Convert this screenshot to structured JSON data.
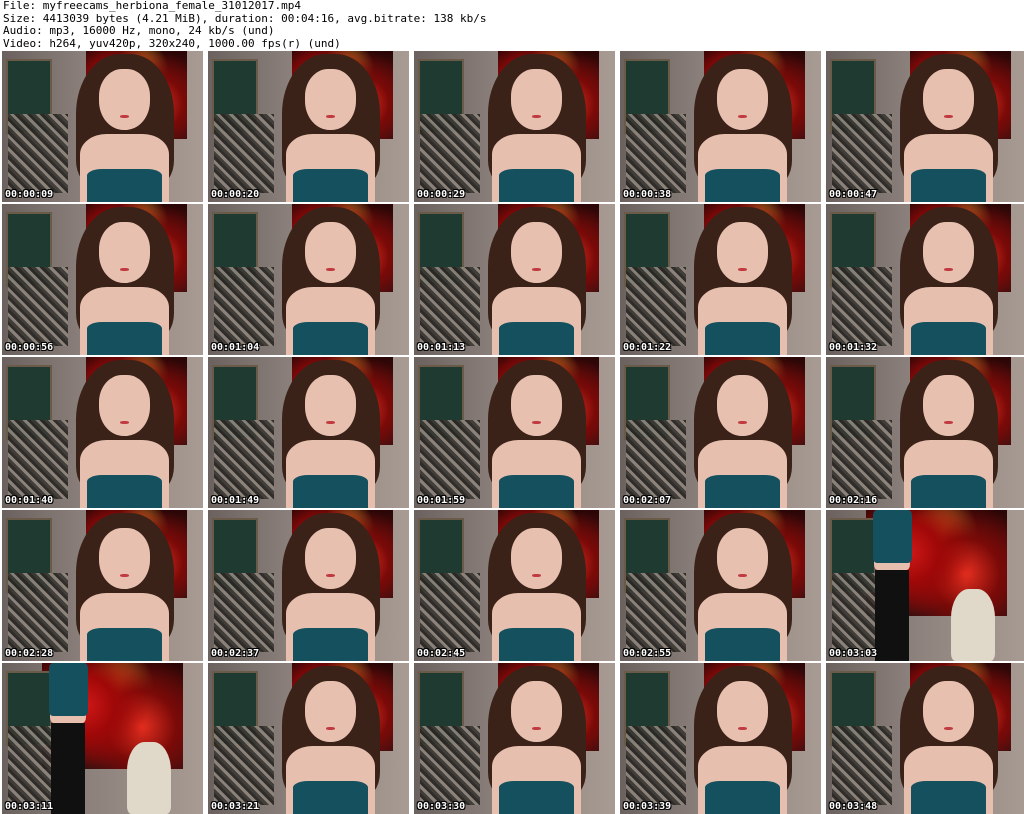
{
  "header": {
    "file_line": "File: myfreecams_herbiona_female_31012017.mp4",
    "size_line": "Size: 4413039 bytes (4.21 MiB), duration: 00:04:16, avg.bitrate: 138 kb/s",
    "audio_line": "Audio: mp3, 16000 Hz, mono, 24 kb/s (und)",
    "video_line": "Video: h264, yuv420p, 320x240, 1000.00 fps(r) (und)"
  },
  "thumbnails": [
    {
      "timestamp": "00:00:09",
      "scene": "seated"
    },
    {
      "timestamp": "00:00:20",
      "scene": "seated"
    },
    {
      "timestamp": "00:00:29",
      "scene": "seated"
    },
    {
      "timestamp": "00:00:38",
      "scene": "seated"
    },
    {
      "timestamp": "00:00:47",
      "scene": "seated"
    },
    {
      "timestamp": "00:00:56",
      "scene": "seated"
    },
    {
      "timestamp": "00:01:04",
      "scene": "seated"
    },
    {
      "timestamp": "00:01:13",
      "scene": "seated"
    },
    {
      "timestamp": "00:01:22",
      "scene": "seated"
    },
    {
      "timestamp": "00:01:32",
      "scene": "seated"
    },
    {
      "timestamp": "00:01:40",
      "scene": "seated"
    },
    {
      "timestamp": "00:01:49",
      "scene": "seated"
    },
    {
      "timestamp": "00:01:59",
      "scene": "seated"
    },
    {
      "timestamp": "00:02:07",
      "scene": "seated"
    },
    {
      "timestamp": "00:02:16",
      "scene": "seated"
    },
    {
      "timestamp": "00:02:28",
      "scene": "seated"
    },
    {
      "timestamp": "00:02:37",
      "scene": "seated"
    },
    {
      "timestamp": "00:02:45",
      "scene": "seated"
    },
    {
      "timestamp": "00:02:55",
      "scene": "seated"
    },
    {
      "timestamp": "00:03:03",
      "scene": "standing"
    },
    {
      "timestamp": "00:03:11",
      "scene": "standing"
    },
    {
      "timestamp": "00:03:21",
      "scene": "seated"
    },
    {
      "timestamp": "00:03:30",
      "scene": "seated"
    },
    {
      "timestamp": "00:03:39",
      "scene": "seated"
    },
    {
      "timestamp": "00:03:48",
      "scene": "seated"
    }
  ]
}
